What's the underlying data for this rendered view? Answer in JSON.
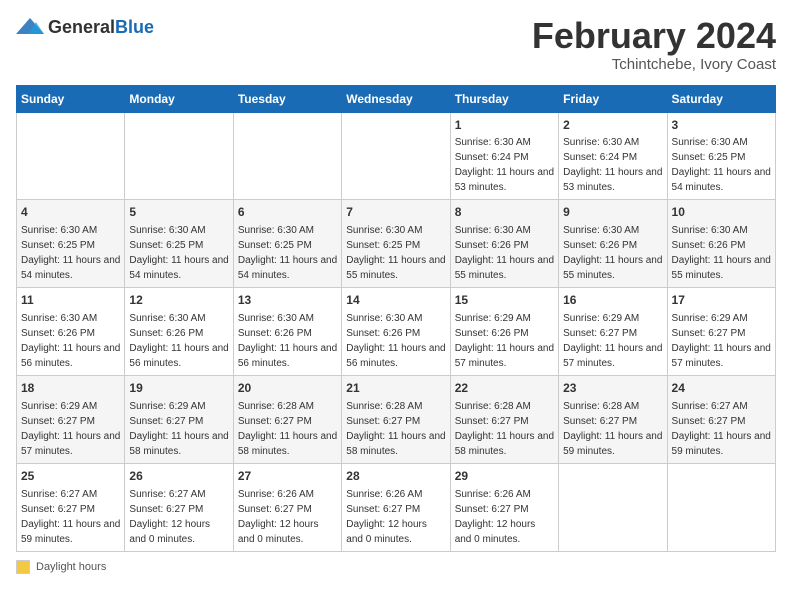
{
  "header": {
    "logo_general": "General",
    "logo_blue": "Blue",
    "main_title": "February 2024",
    "subtitle": "Tchintchebe, Ivory Coast"
  },
  "calendar": {
    "days_of_week": [
      "Sunday",
      "Monday",
      "Tuesday",
      "Wednesday",
      "Thursday",
      "Friday",
      "Saturday"
    ],
    "weeks": [
      [
        {
          "day": "",
          "info": ""
        },
        {
          "day": "",
          "info": ""
        },
        {
          "day": "",
          "info": ""
        },
        {
          "day": "",
          "info": ""
        },
        {
          "day": "1",
          "info": "Sunrise: 6:30 AM\nSunset: 6:24 PM\nDaylight: 11 hours and 53 minutes."
        },
        {
          "day": "2",
          "info": "Sunrise: 6:30 AM\nSunset: 6:24 PM\nDaylight: 11 hours and 53 minutes."
        },
        {
          "day": "3",
          "info": "Sunrise: 6:30 AM\nSunset: 6:25 PM\nDaylight: 11 hours and 54 minutes."
        }
      ],
      [
        {
          "day": "4",
          "info": "Sunrise: 6:30 AM\nSunset: 6:25 PM\nDaylight: 11 hours and 54 minutes."
        },
        {
          "day": "5",
          "info": "Sunrise: 6:30 AM\nSunset: 6:25 PM\nDaylight: 11 hours and 54 minutes."
        },
        {
          "day": "6",
          "info": "Sunrise: 6:30 AM\nSunset: 6:25 PM\nDaylight: 11 hours and 54 minutes."
        },
        {
          "day": "7",
          "info": "Sunrise: 6:30 AM\nSunset: 6:25 PM\nDaylight: 11 hours and 55 minutes."
        },
        {
          "day": "8",
          "info": "Sunrise: 6:30 AM\nSunset: 6:26 PM\nDaylight: 11 hours and 55 minutes."
        },
        {
          "day": "9",
          "info": "Sunrise: 6:30 AM\nSunset: 6:26 PM\nDaylight: 11 hours and 55 minutes."
        },
        {
          "day": "10",
          "info": "Sunrise: 6:30 AM\nSunset: 6:26 PM\nDaylight: 11 hours and 55 minutes."
        }
      ],
      [
        {
          "day": "11",
          "info": "Sunrise: 6:30 AM\nSunset: 6:26 PM\nDaylight: 11 hours and 56 minutes."
        },
        {
          "day": "12",
          "info": "Sunrise: 6:30 AM\nSunset: 6:26 PM\nDaylight: 11 hours and 56 minutes."
        },
        {
          "day": "13",
          "info": "Sunrise: 6:30 AM\nSunset: 6:26 PM\nDaylight: 11 hours and 56 minutes."
        },
        {
          "day": "14",
          "info": "Sunrise: 6:30 AM\nSunset: 6:26 PM\nDaylight: 11 hours and 56 minutes."
        },
        {
          "day": "15",
          "info": "Sunrise: 6:29 AM\nSunset: 6:26 PM\nDaylight: 11 hours and 57 minutes."
        },
        {
          "day": "16",
          "info": "Sunrise: 6:29 AM\nSunset: 6:27 PM\nDaylight: 11 hours and 57 minutes."
        },
        {
          "day": "17",
          "info": "Sunrise: 6:29 AM\nSunset: 6:27 PM\nDaylight: 11 hours and 57 minutes."
        }
      ],
      [
        {
          "day": "18",
          "info": "Sunrise: 6:29 AM\nSunset: 6:27 PM\nDaylight: 11 hours and 57 minutes."
        },
        {
          "day": "19",
          "info": "Sunrise: 6:29 AM\nSunset: 6:27 PM\nDaylight: 11 hours and 58 minutes."
        },
        {
          "day": "20",
          "info": "Sunrise: 6:28 AM\nSunset: 6:27 PM\nDaylight: 11 hours and 58 minutes."
        },
        {
          "day": "21",
          "info": "Sunrise: 6:28 AM\nSunset: 6:27 PM\nDaylight: 11 hours and 58 minutes."
        },
        {
          "day": "22",
          "info": "Sunrise: 6:28 AM\nSunset: 6:27 PM\nDaylight: 11 hours and 58 minutes."
        },
        {
          "day": "23",
          "info": "Sunrise: 6:28 AM\nSunset: 6:27 PM\nDaylight: 11 hours and 59 minutes."
        },
        {
          "day": "24",
          "info": "Sunrise: 6:27 AM\nSunset: 6:27 PM\nDaylight: 11 hours and 59 minutes."
        }
      ],
      [
        {
          "day": "25",
          "info": "Sunrise: 6:27 AM\nSunset: 6:27 PM\nDaylight: 11 hours and 59 minutes."
        },
        {
          "day": "26",
          "info": "Sunrise: 6:27 AM\nSunset: 6:27 PM\nDaylight: 12 hours and 0 minutes."
        },
        {
          "day": "27",
          "info": "Sunrise: 6:26 AM\nSunset: 6:27 PM\nDaylight: 12 hours and 0 minutes."
        },
        {
          "day": "28",
          "info": "Sunrise: 6:26 AM\nSunset: 6:27 PM\nDaylight: 12 hours and 0 minutes."
        },
        {
          "day": "29",
          "info": "Sunrise: 6:26 AM\nSunset: 6:27 PM\nDaylight: 12 hours and 0 minutes."
        },
        {
          "day": "",
          "info": ""
        },
        {
          "day": "",
          "info": ""
        }
      ]
    ]
  },
  "footer": {
    "daylight_label": "Daylight hours"
  }
}
